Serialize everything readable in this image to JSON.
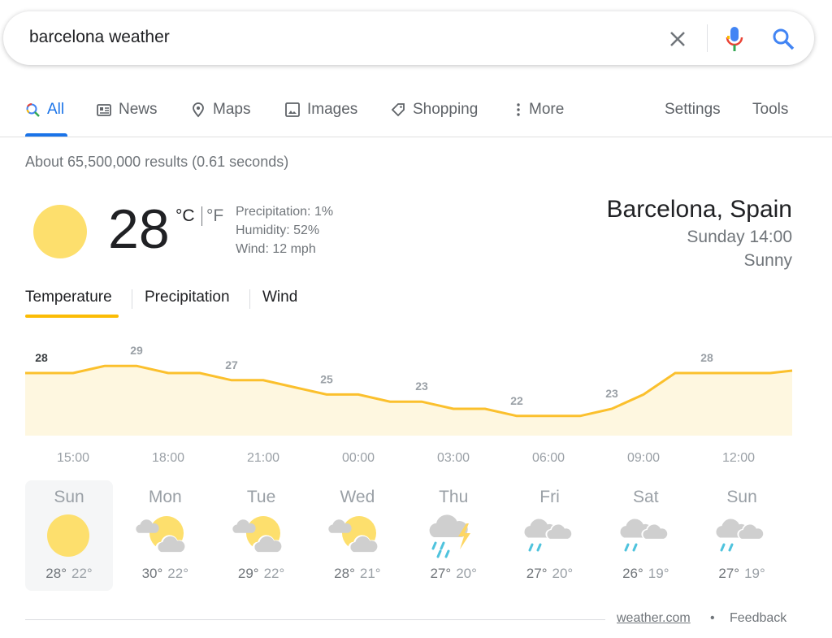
{
  "search": {
    "query": "barcelona weather"
  },
  "tabs": [
    {
      "label": "All",
      "icon": "search-icon",
      "active": true
    },
    {
      "label": "News",
      "icon": "news-icon"
    },
    {
      "label": "Maps",
      "icon": "map-pin-icon"
    },
    {
      "label": "Images",
      "icon": "image-icon"
    },
    {
      "label": "Shopping",
      "icon": "tag-icon"
    },
    {
      "label": "More",
      "icon": "more-vert-icon"
    }
  ],
  "tools": {
    "settings": "Settings",
    "tools": "Tools"
  },
  "stats": "About 65,500,000 results (0.61 seconds)",
  "current": {
    "temp": "28",
    "unit_c": "°C",
    "unit_f": "°F",
    "precipitation": "Precipitation: 1%",
    "humidity": "Humidity: 52%",
    "wind": "Wind: 12 mph",
    "location": "Barcelona, Spain",
    "time": "Sunday 14:00",
    "condition": "Sunny",
    "icon": "sun-icon"
  },
  "weather_tabs": [
    "Temperature",
    "Precipitation",
    "Wind"
  ],
  "colors": {
    "accent": "#1a73e8",
    "line": "#fbc02d",
    "fill": "#fef7e0",
    "sun": "#fddf6d"
  },
  "chart_data": {
    "type": "area",
    "hours": [
      "14:00",
      "15:00",
      "16:00",
      "17:00",
      "18:00",
      "19:00",
      "20:00",
      "21:00",
      "22:00",
      "23:00",
      "00:00",
      "01:00",
      "02:00",
      "03:00",
      "04:00",
      "05:00",
      "06:00",
      "07:00",
      "08:00",
      "09:00",
      "10:00",
      "11:00",
      "12:00",
      "13:00"
    ],
    "values": [
      28,
      28,
      29,
      29,
      28,
      28,
      27,
      27,
      26,
      25,
      25,
      24,
      24,
      23,
      23,
      22,
      22,
      22,
      23,
      25,
      28,
      28,
      28,
      28
    ],
    "labels": [
      {
        "hour": "14:00",
        "text": "28"
      },
      {
        "hour": "17:00",
        "text": "29"
      },
      {
        "hour": "20:00",
        "text": "27"
      },
      {
        "hour": "23:00",
        "text": "25"
      },
      {
        "hour": "02:00",
        "text": "23"
      },
      {
        "hour": "05:00",
        "text": "22"
      },
      {
        "hour": "08:00",
        "text": "23"
      },
      {
        "hour": "11:00",
        "text": "28"
      }
    ],
    "ticks": [
      "15:00",
      "18:00",
      "21:00",
      "00:00",
      "03:00",
      "06:00",
      "09:00",
      "12:00"
    ]
  },
  "forecast": [
    {
      "day": "Sun",
      "hi": "28°",
      "lo": "22°",
      "icon": "sunny"
    },
    {
      "day": "Mon",
      "hi": "30°",
      "lo": "22°",
      "icon": "partly-cloudy"
    },
    {
      "day": "Tue",
      "hi": "29°",
      "lo": "22°",
      "icon": "partly-cloudy"
    },
    {
      "day": "Wed",
      "hi": "28°",
      "lo": "21°",
      "icon": "partly-cloudy"
    },
    {
      "day": "Thu",
      "hi": "27°",
      "lo": "20°",
      "icon": "thunderstorm"
    },
    {
      "day": "Fri",
      "hi": "27°",
      "lo": "20°",
      "icon": "rain"
    },
    {
      "day": "Sat",
      "hi": "26°",
      "lo": "19°",
      "icon": "rain"
    },
    {
      "day": "Sun",
      "hi": "27°",
      "lo": "19°",
      "icon": "rain"
    }
  ],
  "footer": {
    "source": "weather.com",
    "separator": "•",
    "feedback": "Feedback"
  }
}
